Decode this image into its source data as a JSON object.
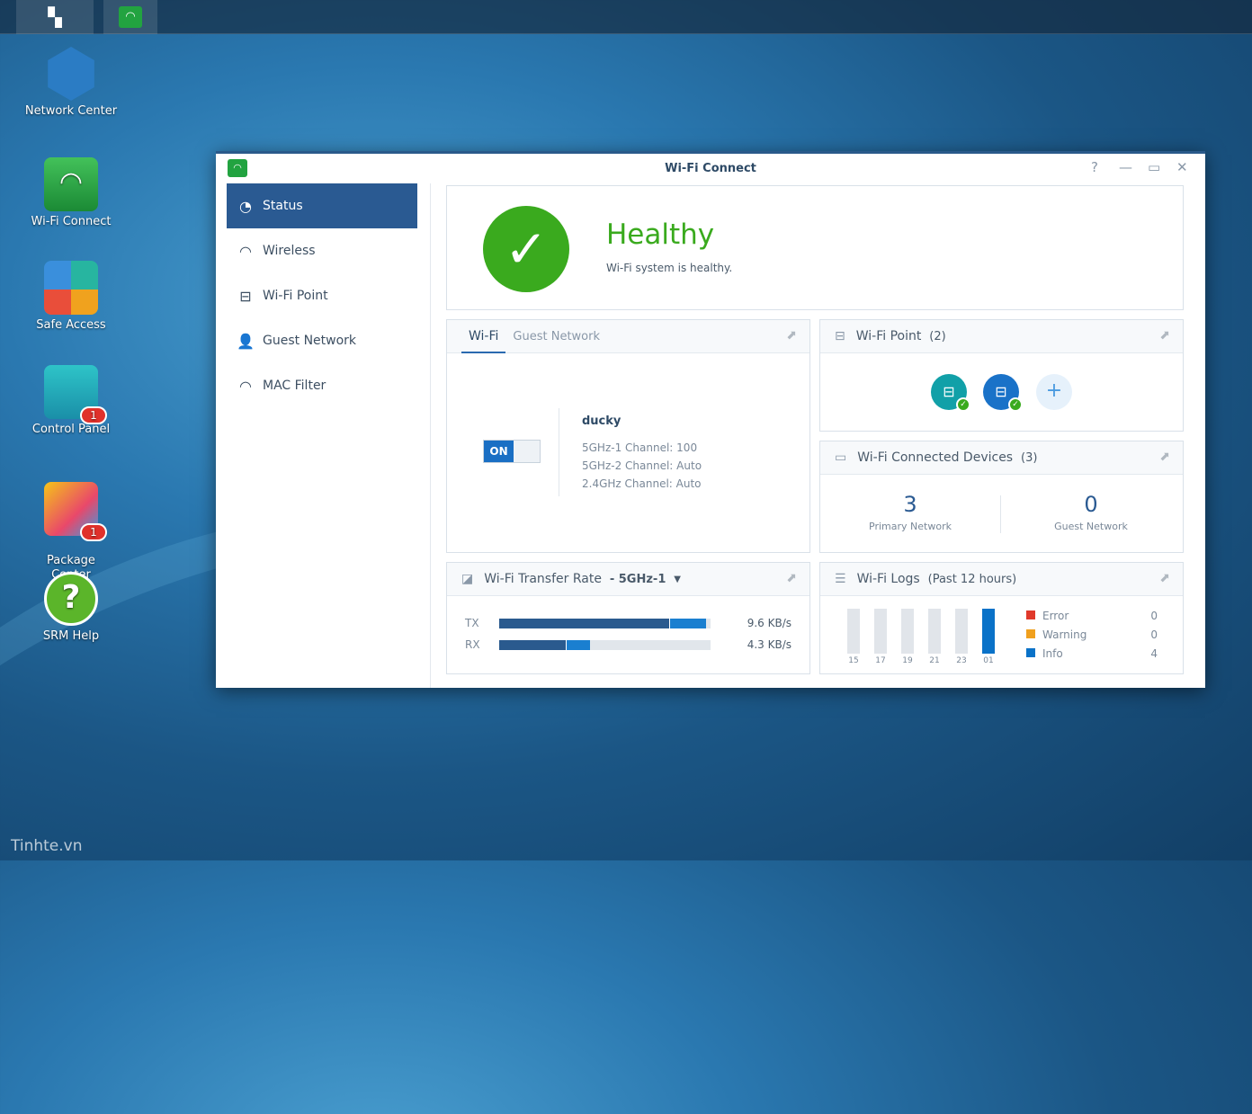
{
  "taskbar": {
    "items": [
      {
        "icon": "main-menu-icon"
      },
      {
        "icon": "wifi-connect-icon"
      }
    ]
  },
  "desktop": {
    "icons": [
      {
        "label": "Network Center",
        "icon": "network-center-icon"
      },
      {
        "label": "Wi-Fi Connect",
        "icon": "wifi-connect-icon"
      },
      {
        "label": "Safe Access",
        "icon": "safe-access-icon"
      },
      {
        "label": "Control Panel",
        "icon": "control-panel-icon",
        "badge": "1"
      },
      {
        "label": "Package\nCenter",
        "icon": "package-center-icon",
        "badge": "1"
      },
      {
        "label": "SRM Help",
        "icon": "help-icon"
      }
    ],
    "watermark": "Tinhte.vn"
  },
  "window": {
    "title": "Wi-Fi Connect",
    "controls": [
      "?",
      "—",
      "▭",
      "✕"
    ]
  },
  "sidebar": {
    "items": [
      {
        "label": "Status",
        "icon": "status-gauge-icon",
        "active": true
      },
      {
        "label": "Wireless",
        "icon": "wifi-icon"
      },
      {
        "label": "Wi-Fi Point",
        "icon": "wifi-point-icon"
      },
      {
        "label": "Guest Network",
        "icon": "guest-icon"
      },
      {
        "label": "MAC Filter",
        "icon": "mac-filter-icon"
      }
    ]
  },
  "status": {
    "title": "Healthy",
    "message": "Wi-Fi system is healthy.",
    "color": "#3aaa1e"
  },
  "wifi_card": {
    "tabs": [
      "Wi-Fi",
      "Guest Network"
    ],
    "active_tab": "Wi-Fi",
    "toggle": "ON",
    "ssid": "ducky",
    "channels": [
      {
        "label": "5GHz-1 Channel:",
        "value": "100"
      },
      {
        "label": "5GHz-2 Channel:",
        "value": "Auto"
      },
      {
        "label": "2.4GHz Channel:",
        "value": "Auto"
      }
    ]
  },
  "wifi_point": {
    "title": "Wi-Fi Point",
    "count": "(2)",
    "add": "+"
  },
  "devices": {
    "title": "Wi-Fi Connected Devices",
    "count": "(3)",
    "primary": {
      "value": "3",
      "label": "Primary Network"
    },
    "guest": {
      "value": "0",
      "label": "Guest Network"
    }
  },
  "transfer": {
    "title": "Wi-Fi Transfer Rate",
    "band": "- 5GHz-1",
    "rows": [
      {
        "label": "TX",
        "value": "9.6 KB/s",
        "dark_pct": 81,
        "light_pct": 98
      },
      {
        "label": "RX",
        "value": "4.3 KB/s",
        "dark_pct": 32,
        "light_pct": 43
      }
    ]
  },
  "logs": {
    "title": "Wi-Fi Logs",
    "subtitle": "(Past 12 hours)",
    "chart_data": {
      "type": "bar",
      "categories": [
        "15",
        "17",
        "19",
        "21",
        "23",
        "01"
      ],
      "values": [
        0,
        0,
        0,
        0,
        0,
        4
      ]
    },
    "legend": [
      {
        "label": "Error",
        "value": "0",
        "color": "#e0392b"
      },
      {
        "label": "Warning",
        "value": "0",
        "color": "#f0a01e"
      },
      {
        "label": "Info",
        "value": "4",
        "color": "#0a72c8"
      }
    ]
  }
}
